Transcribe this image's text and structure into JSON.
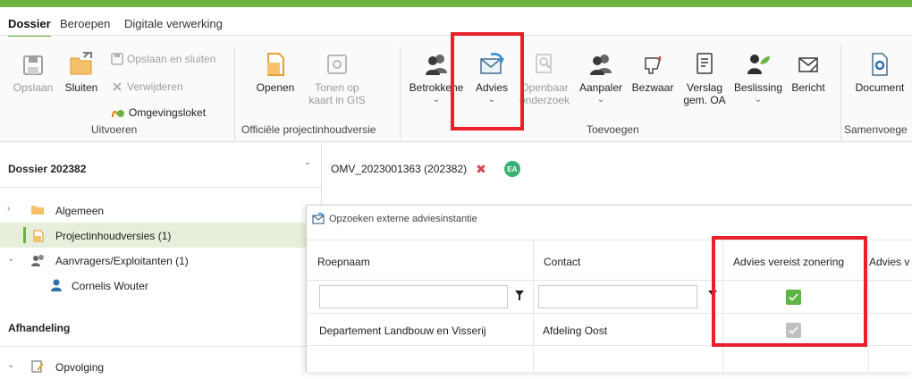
{
  "menu_tabs": [
    {
      "label": "Dossier",
      "active": true
    },
    {
      "label": "Beroepen",
      "active": false
    },
    {
      "label": "Digitale verwerking",
      "active": false
    }
  ],
  "ribbon": {
    "buttons": {
      "opslaan": "Opslaan",
      "sluiten": "Sluiten",
      "opslaan_sluiten": "Opslaan en sluiten",
      "verwijderen": "Verwijderen",
      "omgevingsloket": "Omgevingsloket",
      "openen": "Openen",
      "tonen_op_kaart_1": "Tonen op",
      "tonen_op_kaart_2": "kaart in GIS",
      "betrokkene": "Betrokkene",
      "advies": "Advies",
      "openbaar_1": "Openbaar",
      "openbaar_2": "onderzoek",
      "aanpaler": "Aanpaler",
      "bezwaar": "Bezwaar",
      "verslag_1": "Verslag",
      "verslag_2": "gem. OA",
      "beslissing": "Beslissing",
      "bericht": "Bericht",
      "document": "Document"
    },
    "groups": {
      "uitvoeren": "Uitvoeren",
      "officiele": "Officiële projectinhoudversie",
      "toevoegen": "Toevoegen",
      "samenvoegen": "Samenvoege"
    }
  },
  "left_panel": {
    "dossier_header": "Dossier 202382",
    "items": [
      {
        "label": "Algemeen"
      },
      {
        "label": "Projectinhoudversies (1)"
      },
      {
        "label": "Aanvragers/Exploitanten (1)"
      },
      {
        "label": "Cornelis Wouter"
      }
    ],
    "afhandeling_header": "Afhandeling",
    "opvolging": "Opvolging"
  },
  "doc_tab": {
    "label": "OMV_2023001363 (202382)",
    "badge": "EA"
  },
  "dialog": {
    "title": "Opzoeken externe adviesinstantie",
    "columns": [
      "Roepnaam",
      "Contact",
      "Advies vereist zonering",
      "Advies v"
    ],
    "filters": {
      "roepnaam": "",
      "contact": ""
    },
    "rows": [
      {
        "roepnaam": "Departement Landbouw en Visserij",
        "contact": "Afdeling Oost"
      }
    ]
  },
  "colors": {
    "accent": "#6cb33f",
    "highlight": "#e8202a",
    "checkbox_checked": "#5cb544"
  }
}
